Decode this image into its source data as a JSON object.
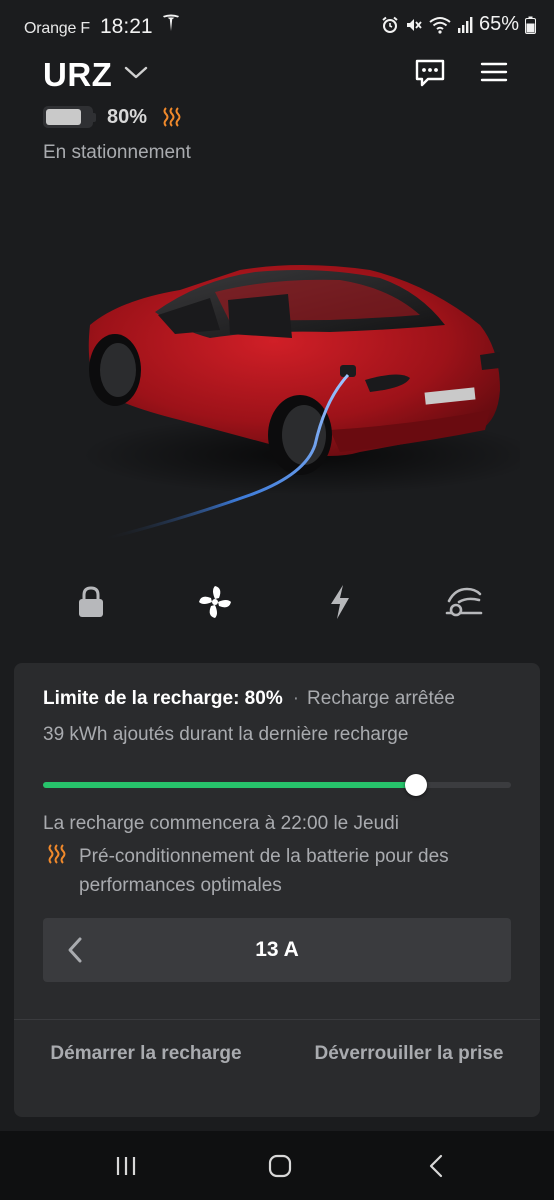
{
  "status_bar": {
    "carrier": "Orange F",
    "time": "18:21",
    "battery_pct": "65%",
    "icons": [
      "tesla-icon",
      "alarm-icon",
      "mute-icon",
      "wifi-icon",
      "signal-icon",
      "battery-icon"
    ]
  },
  "header": {
    "car_name": "URZ",
    "battery_level": 0.8,
    "battery_pct": "80%",
    "state": "En stationnement"
  },
  "quick_controls": [
    "lock-icon",
    "fan-icon",
    "bolt-icon",
    "charge-port-icon"
  ],
  "charge": {
    "limit_label": "Limite de la recharge: 80%",
    "separator": "·",
    "status": "Recharge arrêtée",
    "added": "39 kWh ajoutés durant la dernière recharge",
    "limit_value": 0.8,
    "schedule": "La recharge commencera à 22:00 le Jeudi",
    "precondition": "Pré-conditionnement de la batterie pour des performances optimales",
    "amperage": "13 A",
    "start_action": "Démarrer la recharge",
    "unlock_action": "Déverrouiller la prise"
  },
  "colors": {
    "background": "#1b1c1e",
    "card": "#2a2b2d",
    "accent_green": "#27c36b",
    "heat_orange": "#f0892b",
    "car_red": "#b3141c"
  }
}
